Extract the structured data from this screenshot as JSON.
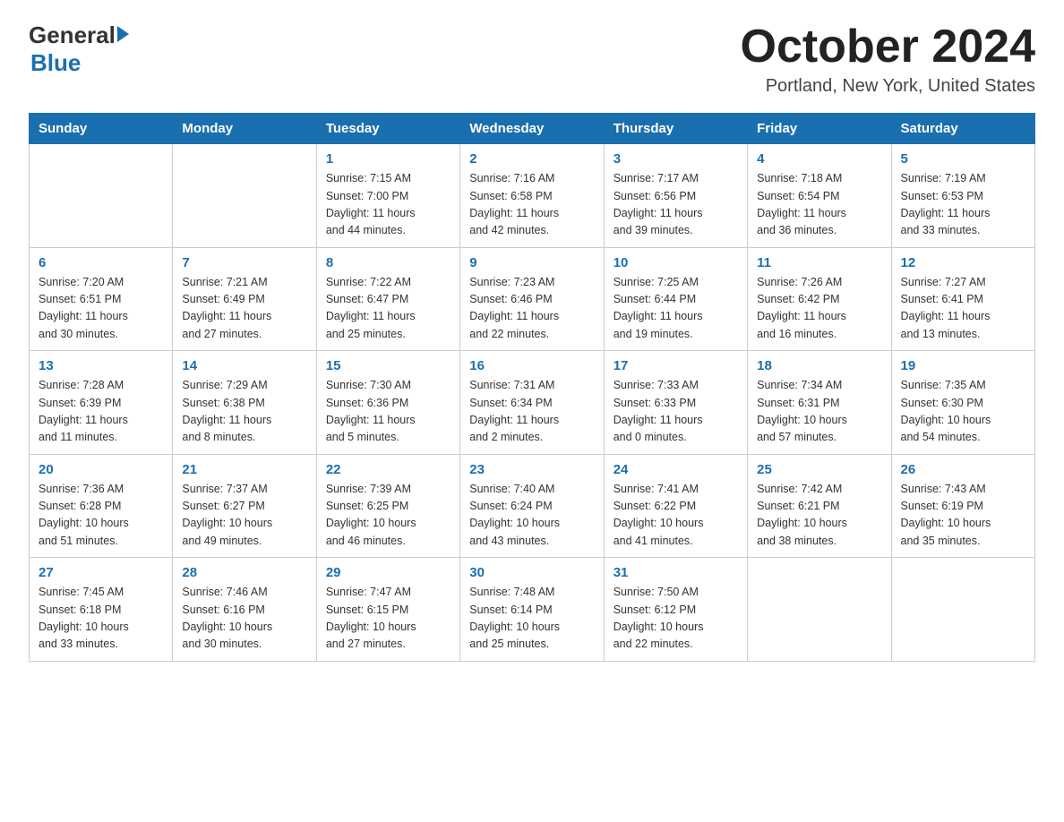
{
  "header": {
    "logo_general": "General",
    "logo_blue": "Blue",
    "month_title": "October 2024",
    "location": "Portland, New York, United States"
  },
  "days_of_week": [
    "Sunday",
    "Monday",
    "Tuesday",
    "Wednesday",
    "Thursday",
    "Friday",
    "Saturday"
  ],
  "weeks": [
    [
      {
        "num": "",
        "info": ""
      },
      {
        "num": "",
        "info": ""
      },
      {
        "num": "1",
        "info": "Sunrise: 7:15 AM\nSunset: 7:00 PM\nDaylight: 11 hours\nand 44 minutes."
      },
      {
        "num": "2",
        "info": "Sunrise: 7:16 AM\nSunset: 6:58 PM\nDaylight: 11 hours\nand 42 minutes."
      },
      {
        "num": "3",
        "info": "Sunrise: 7:17 AM\nSunset: 6:56 PM\nDaylight: 11 hours\nand 39 minutes."
      },
      {
        "num": "4",
        "info": "Sunrise: 7:18 AM\nSunset: 6:54 PM\nDaylight: 11 hours\nand 36 minutes."
      },
      {
        "num": "5",
        "info": "Sunrise: 7:19 AM\nSunset: 6:53 PM\nDaylight: 11 hours\nand 33 minutes."
      }
    ],
    [
      {
        "num": "6",
        "info": "Sunrise: 7:20 AM\nSunset: 6:51 PM\nDaylight: 11 hours\nand 30 minutes."
      },
      {
        "num": "7",
        "info": "Sunrise: 7:21 AM\nSunset: 6:49 PM\nDaylight: 11 hours\nand 27 minutes."
      },
      {
        "num": "8",
        "info": "Sunrise: 7:22 AM\nSunset: 6:47 PM\nDaylight: 11 hours\nand 25 minutes."
      },
      {
        "num": "9",
        "info": "Sunrise: 7:23 AM\nSunset: 6:46 PM\nDaylight: 11 hours\nand 22 minutes."
      },
      {
        "num": "10",
        "info": "Sunrise: 7:25 AM\nSunset: 6:44 PM\nDaylight: 11 hours\nand 19 minutes."
      },
      {
        "num": "11",
        "info": "Sunrise: 7:26 AM\nSunset: 6:42 PM\nDaylight: 11 hours\nand 16 minutes."
      },
      {
        "num": "12",
        "info": "Sunrise: 7:27 AM\nSunset: 6:41 PM\nDaylight: 11 hours\nand 13 minutes."
      }
    ],
    [
      {
        "num": "13",
        "info": "Sunrise: 7:28 AM\nSunset: 6:39 PM\nDaylight: 11 hours\nand 11 minutes."
      },
      {
        "num": "14",
        "info": "Sunrise: 7:29 AM\nSunset: 6:38 PM\nDaylight: 11 hours\nand 8 minutes."
      },
      {
        "num": "15",
        "info": "Sunrise: 7:30 AM\nSunset: 6:36 PM\nDaylight: 11 hours\nand 5 minutes."
      },
      {
        "num": "16",
        "info": "Sunrise: 7:31 AM\nSunset: 6:34 PM\nDaylight: 11 hours\nand 2 minutes."
      },
      {
        "num": "17",
        "info": "Sunrise: 7:33 AM\nSunset: 6:33 PM\nDaylight: 11 hours\nand 0 minutes."
      },
      {
        "num": "18",
        "info": "Sunrise: 7:34 AM\nSunset: 6:31 PM\nDaylight: 10 hours\nand 57 minutes."
      },
      {
        "num": "19",
        "info": "Sunrise: 7:35 AM\nSunset: 6:30 PM\nDaylight: 10 hours\nand 54 minutes."
      }
    ],
    [
      {
        "num": "20",
        "info": "Sunrise: 7:36 AM\nSunset: 6:28 PM\nDaylight: 10 hours\nand 51 minutes."
      },
      {
        "num": "21",
        "info": "Sunrise: 7:37 AM\nSunset: 6:27 PM\nDaylight: 10 hours\nand 49 minutes."
      },
      {
        "num": "22",
        "info": "Sunrise: 7:39 AM\nSunset: 6:25 PM\nDaylight: 10 hours\nand 46 minutes."
      },
      {
        "num": "23",
        "info": "Sunrise: 7:40 AM\nSunset: 6:24 PM\nDaylight: 10 hours\nand 43 minutes."
      },
      {
        "num": "24",
        "info": "Sunrise: 7:41 AM\nSunset: 6:22 PM\nDaylight: 10 hours\nand 41 minutes."
      },
      {
        "num": "25",
        "info": "Sunrise: 7:42 AM\nSunset: 6:21 PM\nDaylight: 10 hours\nand 38 minutes."
      },
      {
        "num": "26",
        "info": "Sunrise: 7:43 AM\nSunset: 6:19 PM\nDaylight: 10 hours\nand 35 minutes."
      }
    ],
    [
      {
        "num": "27",
        "info": "Sunrise: 7:45 AM\nSunset: 6:18 PM\nDaylight: 10 hours\nand 33 minutes."
      },
      {
        "num": "28",
        "info": "Sunrise: 7:46 AM\nSunset: 6:16 PM\nDaylight: 10 hours\nand 30 minutes."
      },
      {
        "num": "29",
        "info": "Sunrise: 7:47 AM\nSunset: 6:15 PM\nDaylight: 10 hours\nand 27 minutes."
      },
      {
        "num": "30",
        "info": "Sunrise: 7:48 AM\nSunset: 6:14 PM\nDaylight: 10 hours\nand 25 minutes."
      },
      {
        "num": "31",
        "info": "Sunrise: 7:50 AM\nSunset: 6:12 PM\nDaylight: 10 hours\nand 22 minutes."
      },
      {
        "num": "",
        "info": ""
      },
      {
        "num": "",
        "info": ""
      }
    ]
  ]
}
